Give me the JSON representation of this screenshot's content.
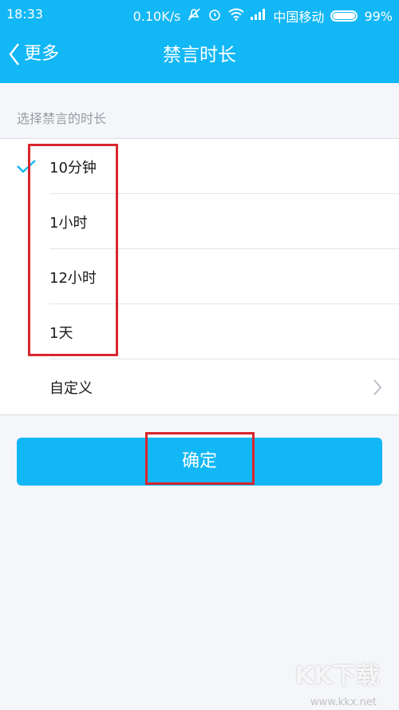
{
  "status_bar": {
    "time": "18:33",
    "speed": "0.10K/s",
    "carrier": "中国移动",
    "battery": "99%",
    "icons": [
      "mute-icon",
      "alarm-icon",
      "wifi-icon",
      "signal-icon",
      "battery-icon"
    ]
  },
  "nav": {
    "back_label": "更多",
    "title": "禁言时长"
  },
  "section_label": "选择禁言的时长",
  "options": [
    {
      "label": "10分钟",
      "selected": true
    },
    {
      "label": "1小时",
      "selected": false
    },
    {
      "label": "12小时",
      "selected": false
    },
    {
      "label": "1天",
      "selected": false
    }
  ],
  "custom_label": "自定义",
  "confirm_label": "确定",
  "watermark": {
    "main": "KK下载",
    "sub": "www.kkx.net"
  },
  "colors": {
    "accent": "#12b7f5",
    "highlight": "#d9252d"
  }
}
